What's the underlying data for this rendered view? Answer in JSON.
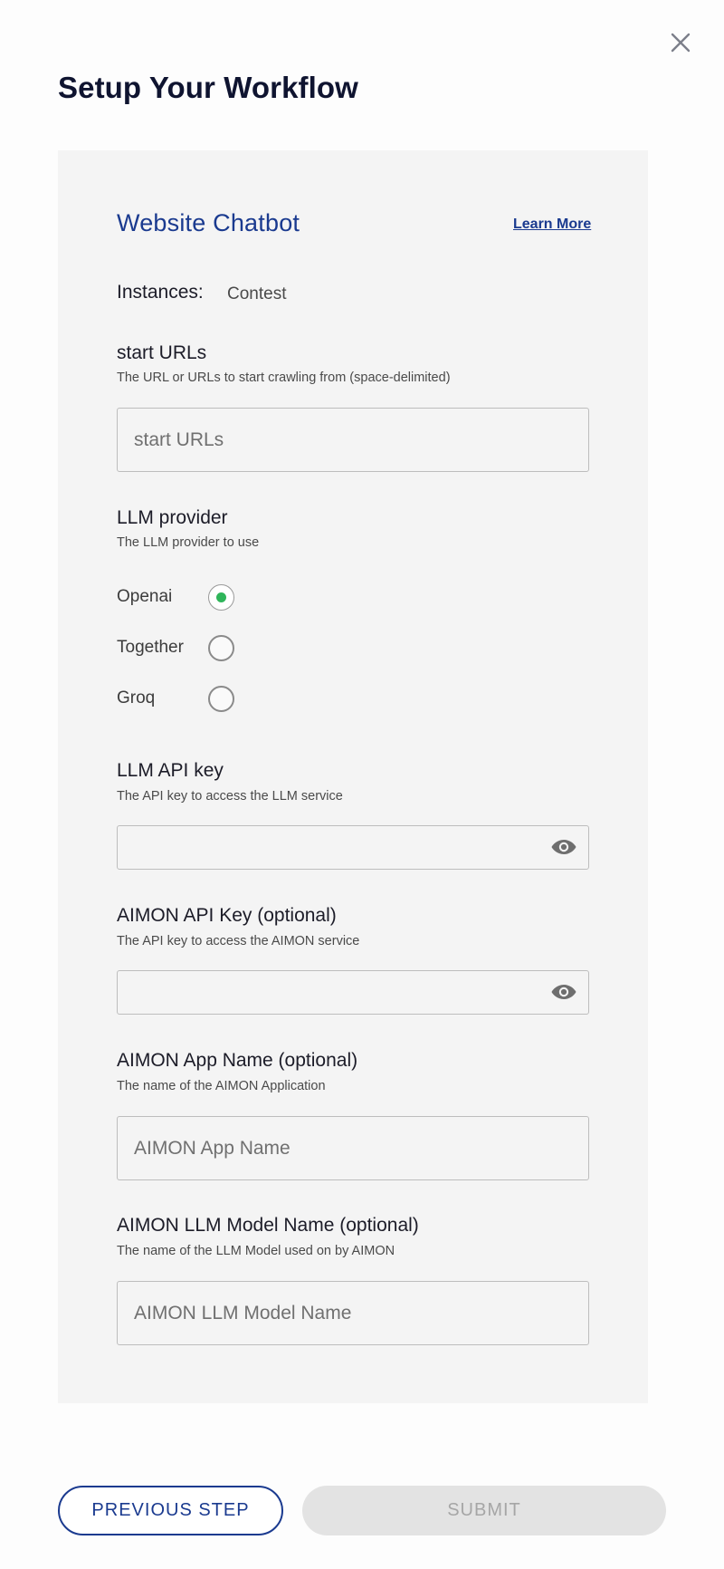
{
  "modal": {
    "title": "Setup Your Workflow",
    "close_icon": "close-icon"
  },
  "card": {
    "title": "Website Chatbot",
    "learn_more": "Learn More",
    "instances_label": "Instances:",
    "instances_value": "Contest"
  },
  "fields": {
    "start_urls": {
      "label": "start URLs",
      "help": "The URL or URLs to start crawling from (space-delimited)",
      "placeholder": "start URLs",
      "value": ""
    },
    "llm_provider": {
      "label": "LLM provider",
      "help": "The LLM provider to use",
      "options": [
        "Openai",
        "Together",
        "Groq"
      ],
      "selected": "Openai"
    },
    "llm_api_key": {
      "label": "LLM API key",
      "help": "The API key to access the LLM service",
      "value": "",
      "icon": "eye-icon"
    },
    "aimon_api_key": {
      "label": "AIMON API Key (optional)",
      "help": "The API key to access the AIMON service",
      "value": "",
      "icon": "eye-icon"
    },
    "aimon_app_name": {
      "label": "AIMON App Name (optional)",
      "help": "The name of the AIMON Application",
      "placeholder": "AIMON App Name",
      "value": ""
    },
    "aimon_llm_model": {
      "label": "AIMON LLM Model Name (optional)",
      "help": "The name of the LLM Model used on by AIMON",
      "placeholder": "AIMON LLM Model Name",
      "value": ""
    }
  },
  "footer": {
    "previous_label": "PREVIOUS STEP",
    "submit_label": "SUBMIT"
  },
  "colors": {
    "accent": "#1a3a8f",
    "radio_selected": "#2fb55a",
    "card_bg": "#f4f4f4"
  }
}
